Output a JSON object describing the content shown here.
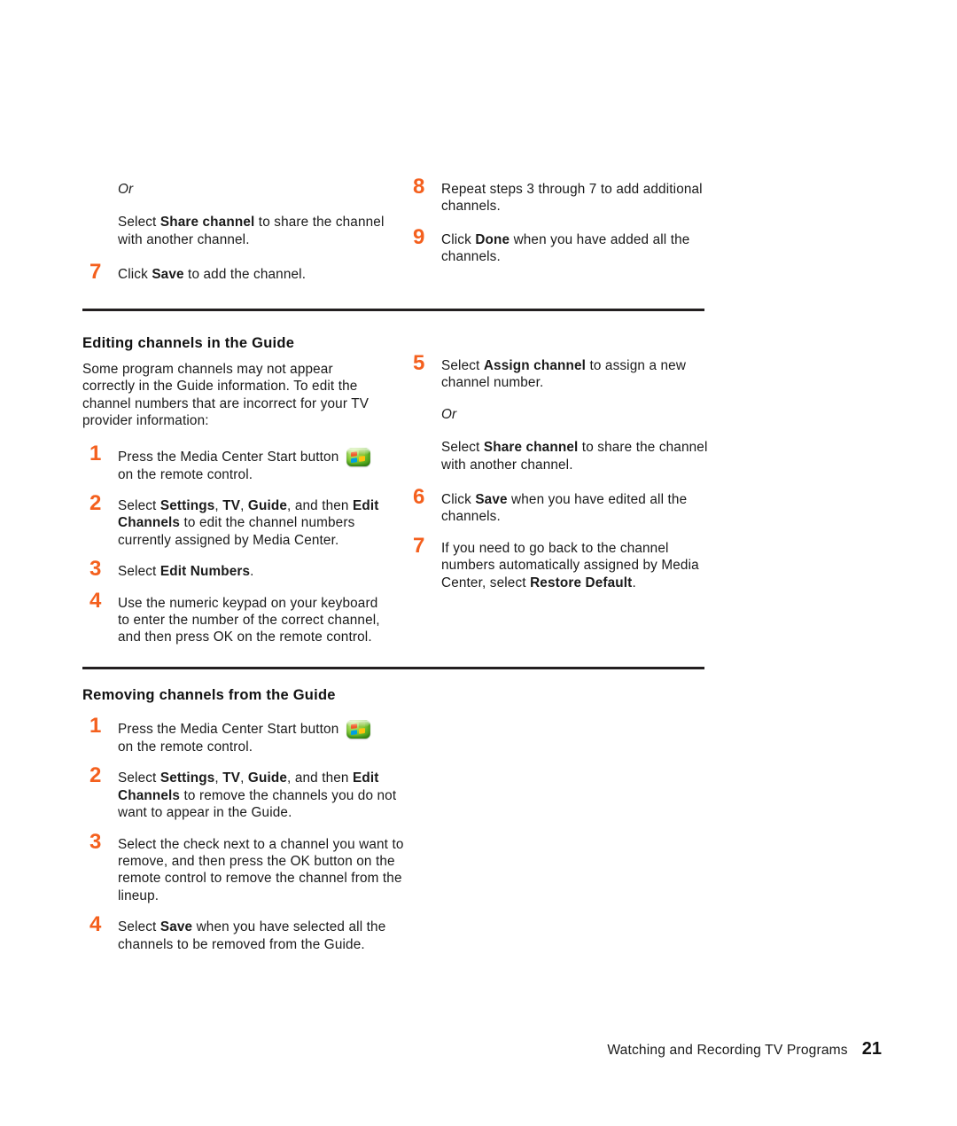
{
  "page": {
    "number": "21",
    "footer_title": "Watching and Recording TV Programs",
    "accent_orange": "#F4601E",
    "rule_color": "#231F20"
  },
  "top_section": {
    "left_column": {
      "or_label": "Or",
      "share_pre": "Select ",
      "share_bold": "Share channel",
      "share_post": " to share the channel with another channel.",
      "step7_num": "7",
      "step7_pre": "Click ",
      "step7_bold": "Save",
      "step7_post": " to add the channel."
    },
    "right_column": {
      "step8_num": "8",
      "step8_text": "Repeat steps 3 through 7 to add additional channels.",
      "step9_num": "9",
      "step9_pre": "Click ",
      "step9_bold": "Done",
      "step9_post": " when you have added all the channels."
    }
  },
  "editing_section": {
    "title": "Editing channels in the Guide",
    "intro": "Some program channels may not appear correctly in the Guide information. To edit the channel numbers that are incorrect for your TV provider information:",
    "left_steps": [
      {
        "num": "1",
        "pre": "Press the Media Center Start button ",
        "icon": "media-center-start-icon",
        "post": " on the remote control."
      },
      {
        "num": "2",
        "seg1": "Select ",
        "b1": "Settings",
        "seg2": ", ",
        "b2": "TV",
        "seg3": ", ",
        "b3": "Guide",
        "seg4": ", and then ",
        "b4": "Edit Channels",
        "seg5": " to edit the channel numbers currently assigned by Media Center."
      },
      {
        "num": "3",
        "pre": "Select ",
        "bold": "Edit Numbers",
        "post": "."
      },
      {
        "num": "4",
        "text": "Use the numeric keypad on your keyboard to enter the number of the correct channel, and then press OK on the remote control."
      }
    ],
    "right_steps": [
      {
        "num": "5",
        "pre": "Select ",
        "bold": "Assign channel",
        "post": " to assign a new channel number."
      },
      {
        "or_label": "Or",
        "pre": "Select ",
        "bold": "Share channel",
        "post": " to share the channel with another channel."
      },
      {
        "num": "6",
        "pre": "Click ",
        "bold": "Save",
        "post": " when you have edited all the channels."
      },
      {
        "num": "7",
        "pre": "If you need to go back to the channel numbers automatically assigned by Media Center, select ",
        "bold": "Restore Default",
        "post": "."
      }
    ]
  },
  "removing_section": {
    "title": "Removing channels from the Guide",
    "steps": [
      {
        "num": "1",
        "pre": "Press the Media Center Start button ",
        "icon": "media-center-start-icon",
        "post": " on the remote control."
      },
      {
        "num": "2",
        "seg1": "Select ",
        "b1": "Settings",
        "seg2": ", ",
        "b2": "TV",
        "seg3": ", ",
        "b3": "Guide",
        "seg4": ", and then ",
        "b4": "Edit Channels",
        "seg5": " to remove the channels you do not want to appear in the Guide."
      },
      {
        "num": "3",
        "text": "Select the check next to a channel you want to remove, and then press the OK button on the remote control to remove the channel from the lineup."
      },
      {
        "num": "4",
        "pre": "Select ",
        "bold": "Save",
        "post": " when you have selected all the channels to be removed from the Guide."
      }
    ]
  }
}
